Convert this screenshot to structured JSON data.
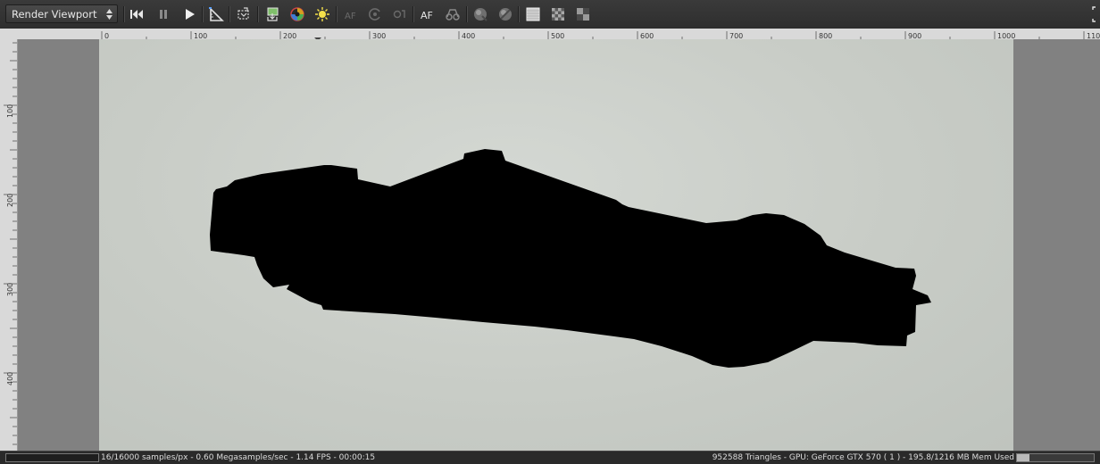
{
  "toolbar": {
    "viewport_mode": "Render Viewport",
    "buttons": [
      {
        "name": "rewind-icon"
      },
      {
        "name": "pause-icon"
      },
      {
        "name": "play-icon"
      },
      {
        "name": "ruler-triangle-icon"
      },
      {
        "name": "region-select-icon"
      },
      {
        "name": "export-image-icon"
      },
      {
        "name": "color-picker-icon"
      },
      {
        "name": "light-pick-icon"
      },
      {
        "name": "autofocus-picker-icon",
        "label": "AF"
      },
      {
        "name": "camera-target-icon"
      },
      {
        "name": "focus-picker-icon"
      },
      {
        "name": "autofocus-toggle",
        "label": "AF"
      },
      {
        "name": "stereo-glasses-icon"
      },
      {
        "name": "sphere-lock-icon"
      },
      {
        "name": "sphere-unlock-icon"
      },
      {
        "name": "background-fill-icon"
      },
      {
        "name": "checker-alpha-icon"
      },
      {
        "name": "checker-small-icon"
      }
    ]
  },
  "ruler": {
    "horizontal_labels": [
      "0",
      "100",
      "200",
      "300",
      "400",
      "500",
      "600",
      "700",
      "800",
      "900",
      "1000",
      "110"
    ],
    "vertical_labels": [
      "100",
      "200",
      "300",
      "400"
    ]
  },
  "status": {
    "left": "16/16000 samples/px - 0.60 Megasamples/sec - 1.14 FPS - 00:00:15",
    "right": "952588 Triangles - GPU: GeForce GTX 570 ( 1 ) - 195.8/1216 MB Mem Used",
    "memory_used_fraction": 0.16
  },
  "colors": {
    "toolbar_bg": "#333333",
    "render_bg": "#c8ccc6",
    "silhouette": "#000000"
  }
}
